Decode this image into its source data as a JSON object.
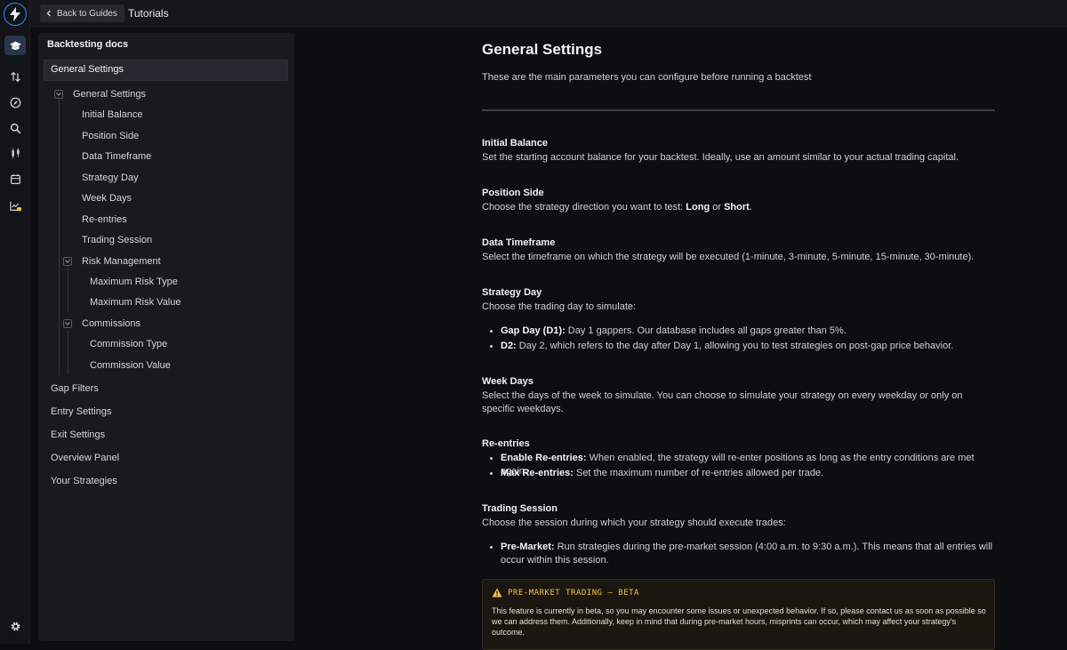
{
  "rail": {
    "icons": [
      "logo-bolt-icon",
      "graduation-cap-icon",
      "arrows-updown-icon",
      "compass-icon",
      "search-magnify-icon",
      "candles-icon",
      "calendar-icon",
      "chart-lock-icon",
      "settings-gear-icon"
    ]
  },
  "topbar": {
    "back_label": "Back to Guides",
    "title": "Tutorials"
  },
  "sidebar": {
    "title": "Backtesting docs",
    "selected": "General Settings",
    "group_general": "General Settings",
    "items": {
      "initial_balance": "Initial Balance",
      "position_side": "Position Side",
      "data_timeframe": "Data Timeframe",
      "strategy_day": "Strategy Day",
      "week_days": "Week Days",
      "re_entries": "Re-entries",
      "trading_session": "Trading Session",
      "risk_management": "Risk Management",
      "max_risk_type": "Maximum Risk Type",
      "max_risk_value": "Maximum Risk Value",
      "commissions": "Commissions",
      "commission_type": "Commission Type",
      "commission_value": "Commission Value"
    },
    "sections": {
      "gap_filters": "Gap Filters",
      "entry_settings": "Entry Settings",
      "exit_settings": "Exit Settings",
      "overview_panel": "Overview Panel",
      "your_strategies": "Your Strategies"
    }
  },
  "main": {
    "title": "General Settings",
    "intro": "These are the main parameters you can configure before running a backtest",
    "initial_balance": {
      "heading": "Initial Balance",
      "text": "Set the starting account balance for your backtest. Ideally, use an amount similar to your actual trading capital."
    },
    "position_side": {
      "heading": "Position Side",
      "text_before": "Choose the strategy direction you want to test: ",
      "long": "Long",
      "or": " or ",
      "short": "Short",
      "end": "."
    },
    "data_timeframe": {
      "heading": "Data Timeframe",
      "text": "Select the timeframe on which the strategy will be executed (1-minute, 3-minute, 5-minute, 15-minute, 30-minute)."
    },
    "strategy_day": {
      "heading": "Strategy Day",
      "text": "Choose the trading day to simulate:",
      "b1_label": "Gap Day (D1):",
      "b1_text": " Day 1 gappers. Our database includes all gaps greater than 5%.",
      "b2_label": "D2:",
      "b2_text": " Day 2, which refers to the day after Day 1, allowing you to test strategies on post-gap price behavior."
    },
    "week_days": {
      "heading": "Week Days",
      "text": "Select the days of the week to simulate. You can choose to simulate your strategy on every weekday or only on specific weekdays."
    },
    "re_entries": {
      "heading": "Re-entries",
      "b1_label": "Enable Re-entries:",
      "b1_text": " When enabled, the strategy will re-enter positions as long as the entry conditions are met again.",
      "b2_label": "Max Re-entries:",
      "b2_text": " Set the maximum number of re-entries allowed per trade."
    },
    "trading_session": {
      "heading": "Trading Session",
      "text": "Choose the session during which your strategy should execute trades:",
      "b1_label": "Pre-Market:",
      "b1_text": " Run strategies during the pre-market session (4:00 a.m. to 9:30 a.m.). This means that all entries will occur within this session."
    },
    "warning": {
      "title": "PRE-MARKET TRADING — BETA",
      "text": "This feature is currently in beta, so you may encounter some issues or unexpected behavior. If so, please contact us as soon as possible so we can address them. Additionally, keep in mind that during pre-market hours, misprints can occur, which may affect your strategy's outcome."
    },
    "accent": "#3b82f6",
    "warn_color": "#f4c14a"
  }
}
